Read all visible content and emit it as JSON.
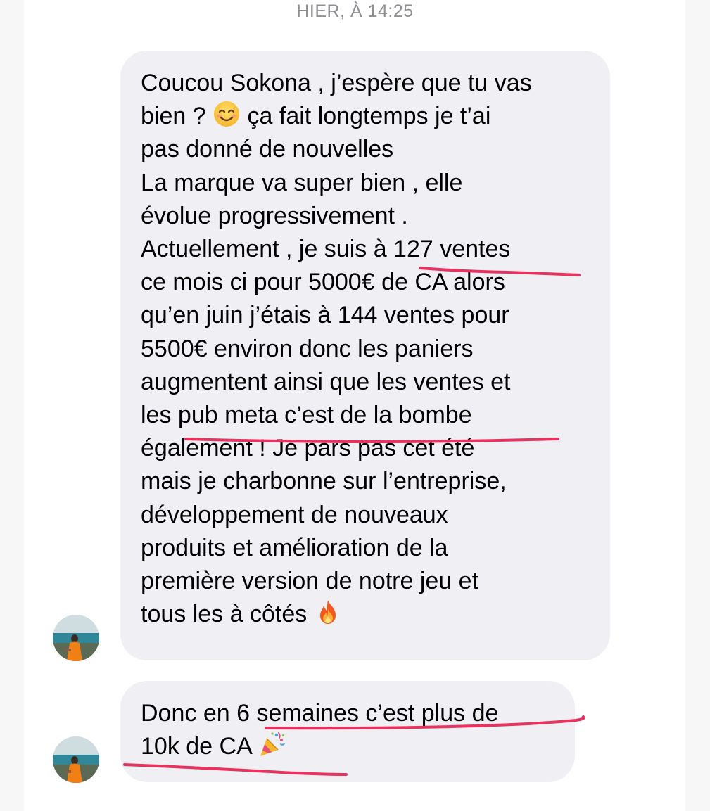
{
  "header": {
    "timestamp": "HIER, À 14:25"
  },
  "messages": [
    {
      "lines": [
        "Coucou Sokona , j’espère que tu vas",
        "bien ? ",
        "pas donné de nouvelles",
        "La marque va super bien , elle",
        "évolue progressivement .",
        "Actuellement , je suis à 127 ventes",
        "ce mois ci pour 5000€ de CA alors",
        "qu’en juin j’étais à 144 ventes pour",
        "5500€ environ donc les paniers",
        "augmentent ainsi que les ventes et",
        "les pub meta c’est de la bombe",
        "également ! Je pars pas cet été",
        "mais je charbonne sur l’entreprise,",
        "développement de nouveaux",
        "produits et amélioration de la",
        "première version de notre jeu et",
        "tous les à côtés "
      ],
      "line2_tail": " ça fait longtemps je t’ai",
      "emojis": [
        "smiling-face-icon",
        "fire-icon"
      ]
    },
    {
      "lines": [
        "Donc en 6 semaines c’est plus de",
        "10k de CA "
      ],
      "emojis": [
        "party-popper-icon"
      ]
    }
  ],
  "colors": {
    "bubble": "#efeff4",
    "timestamp": "#8e8e93",
    "underline": "#e8325f"
  }
}
